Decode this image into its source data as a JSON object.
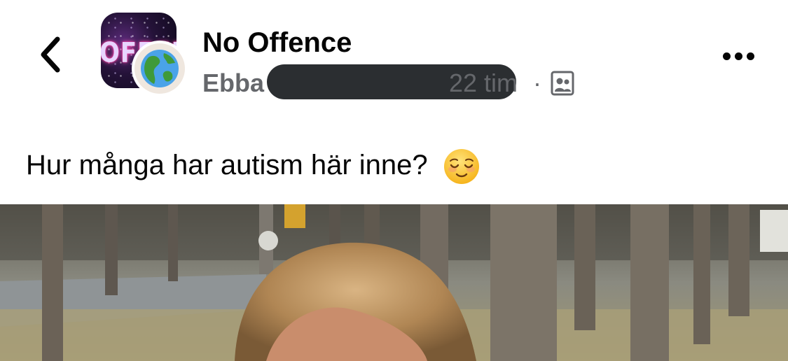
{
  "header": {
    "back_icon": "chevron-left-icon",
    "group_name": "No Offence",
    "group_logo_text": "OFFEN",
    "author_visible": "Ebba",
    "timestamp": "22 tim",
    "separator": "·",
    "audience_icon": "group-photo-icon",
    "more_icon": "more-horizontal-icon"
  },
  "post": {
    "text": "Hur många har autism här inne?",
    "emoji": "relieved-face-emoji"
  },
  "photo": {
    "subject": "photo"
  },
  "colors": {
    "text_primary": "#050505",
    "text_secondary": "#65676b",
    "redaction": "#2b2e31",
    "background": "#ffffff"
  }
}
